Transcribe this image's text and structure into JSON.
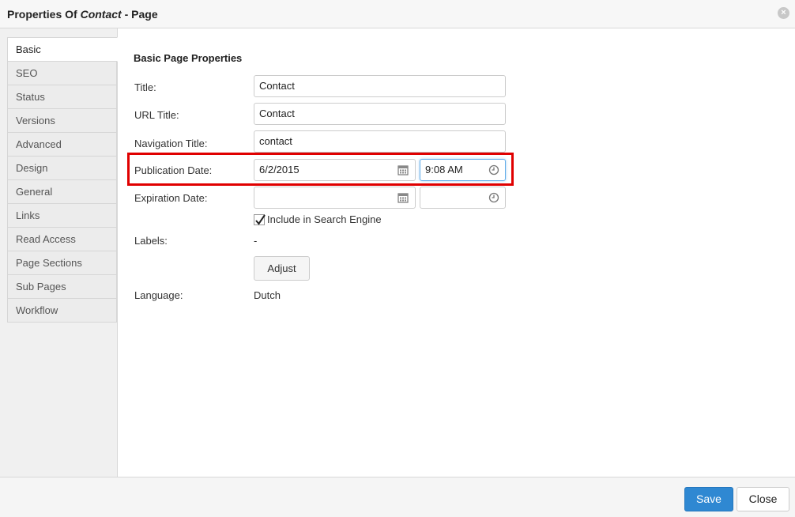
{
  "dialog": {
    "title_prefix": "Properties Of ",
    "title_object": "Contact",
    "title_suffix": " - Page"
  },
  "sidebar": {
    "items": [
      {
        "label": "Basic",
        "active": true
      },
      {
        "label": "SEO"
      },
      {
        "label": "Status"
      },
      {
        "label": "Versions"
      },
      {
        "label": "Advanced"
      },
      {
        "label": "Design"
      },
      {
        "label": "General"
      },
      {
        "label": "Links"
      },
      {
        "label": "Read Access"
      },
      {
        "label": "Page Sections"
      },
      {
        "label": "Sub Pages"
      },
      {
        "label": "Workflow"
      }
    ]
  },
  "form": {
    "section_title": "Basic Page Properties",
    "title_label": "Title:",
    "title_value": "Contact",
    "url_title_label": "URL Title:",
    "url_title_value": "Contact",
    "nav_title_label": "Navigation Title:",
    "nav_title_value": "contact",
    "pub_date_label": "Publication Date:",
    "pub_date_value": "6/2/2015",
    "pub_time_value": "9:08 AM",
    "exp_date_label": "Expiration Date:",
    "exp_date_value": "",
    "exp_time_value": "",
    "search_engine_label": "Include in Search Engine",
    "search_engine_checked": true,
    "labels_label": "Labels:",
    "labels_value": "-",
    "adjust_label": "Adjust",
    "language_label": "Language:",
    "language_value": "Dutch"
  },
  "footer": {
    "save_label": "Save",
    "close_label": "Close"
  },
  "colors": {
    "primary": "#2f88d2",
    "highlight": "#e00000"
  }
}
